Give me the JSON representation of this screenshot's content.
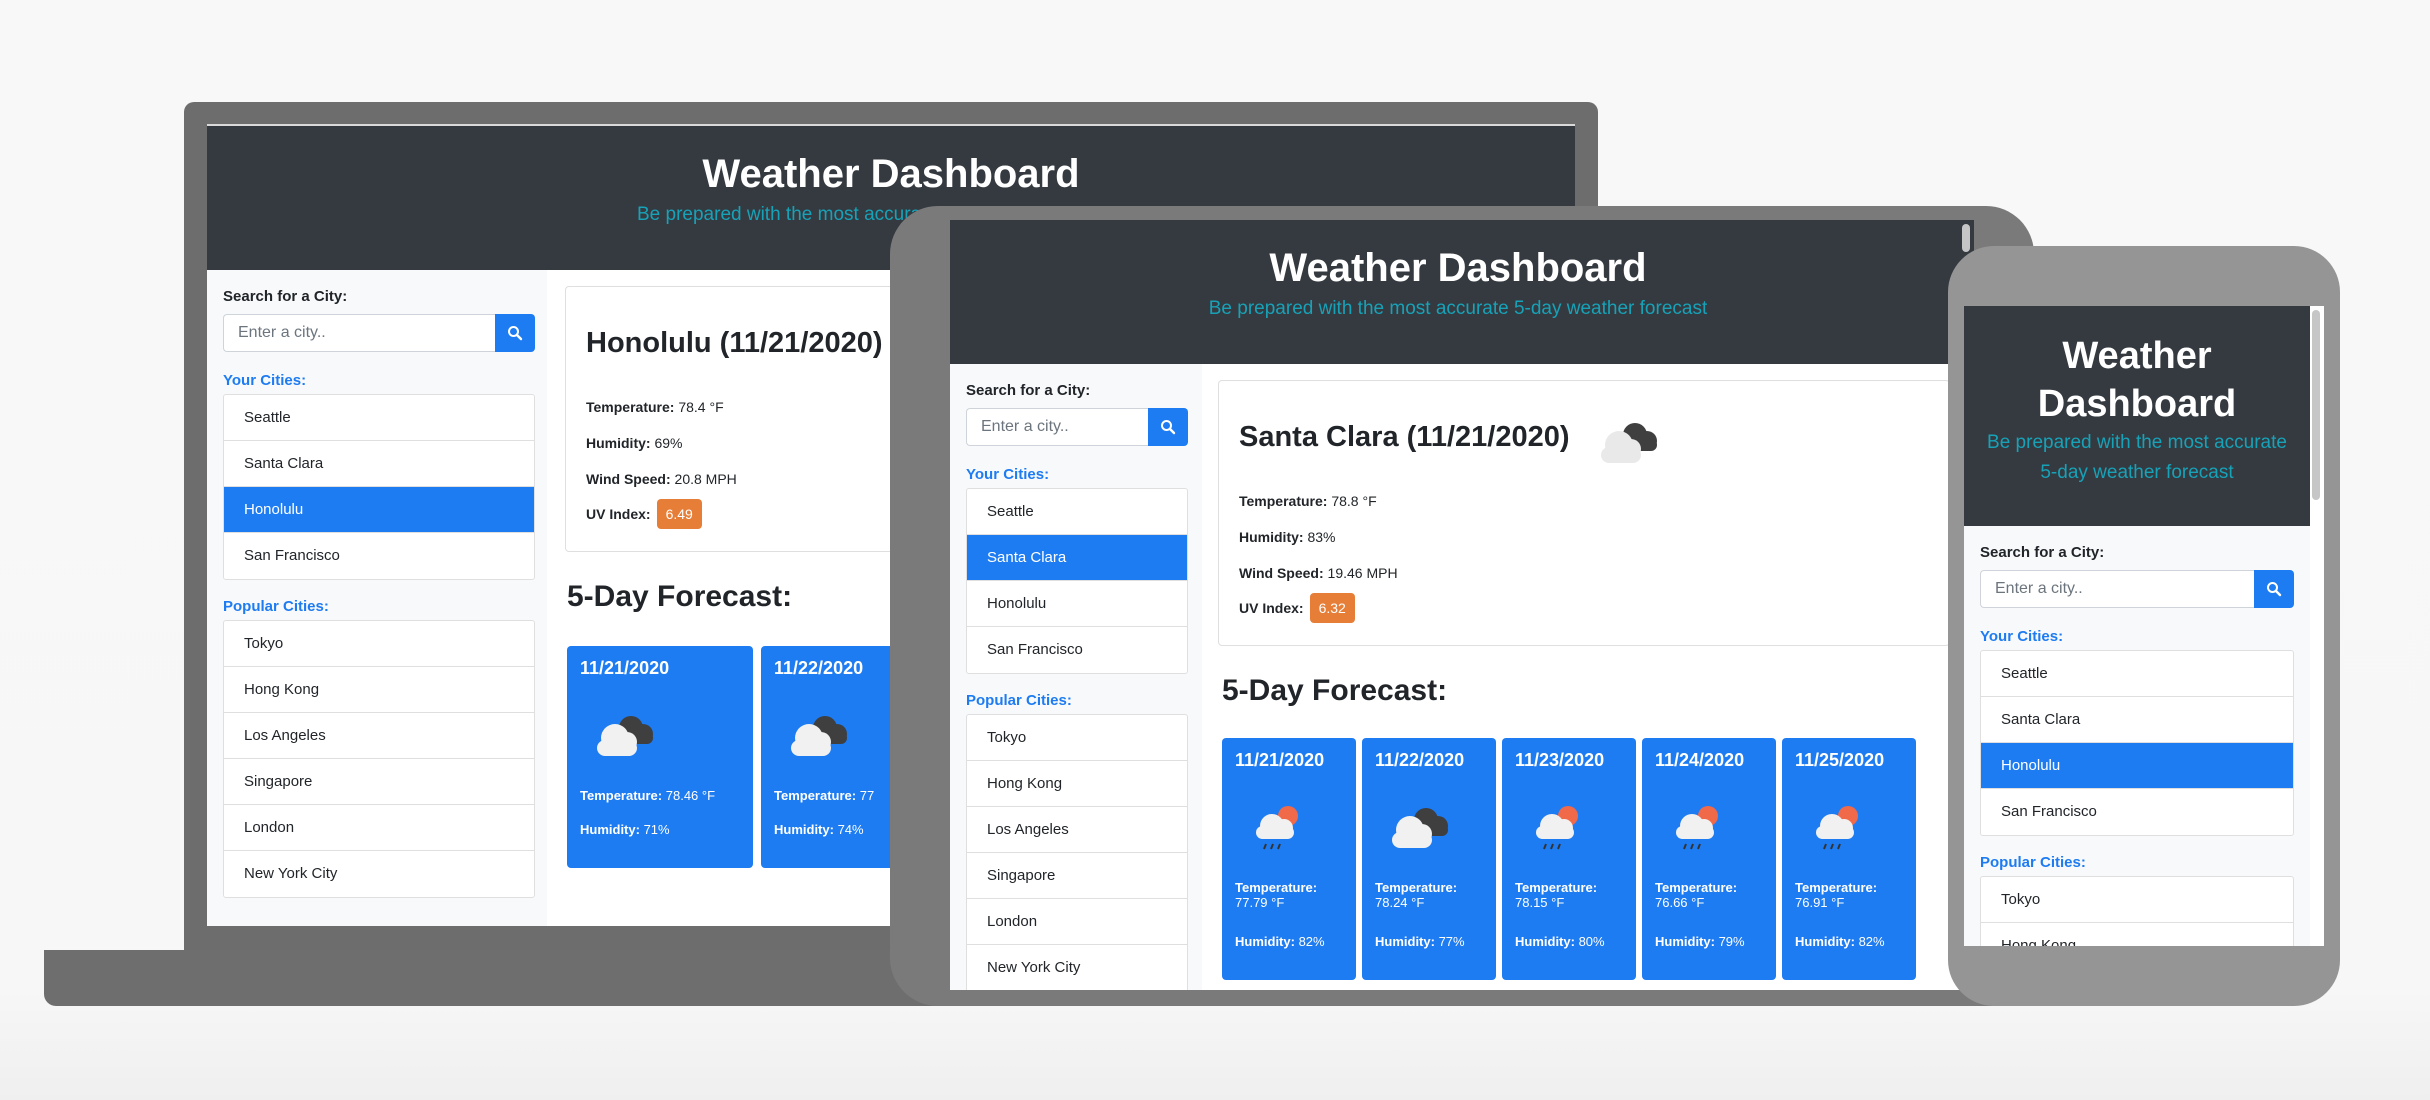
{
  "app": {
    "title": "Weather Dashboard",
    "subtitle": "Be prepared with the most accurate 5-day weather forecast",
    "subtitle_cropped": "Be prepared with the most accura"
  },
  "sidebar": {
    "search_label": "Search for a City:",
    "search_placeholder": "Enter a city..",
    "your_cities_label": "Your Cities:",
    "popular_cities_label": "Popular Cities:",
    "your_cities": [
      "Seattle",
      "Santa Clara",
      "Honolulu",
      "San Francisco"
    ],
    "popular_cities": [
      "Tokyo",
      "Hong Kong",
      "Los Angeles",
      "Singapore",
      "London",
      "New York City"
    ]
  },
  "laptop": {
    "selected_city": "Honolulu",
    "current": {
      "title": "Honolulu (11/21/2020)",
      "temperature_label": "Temperature:",
      "temperature": "78.4 °F",
      "humidity_label": "Humidity:",
      "humidity": "69%",
      "wind_label": "Wind Speed:",
      "wind": "20.8 MPH",
      "uv_label": "UV Index:",
      "uv": "6.49"
    },
    "forecast_title": "5-Day Forecast:",
    "forecast": [
      {
        "date": "11/21/2020",
        "icon": "cloudy-icon",
        "temp": "78.46 °F",
        "humidity": "71%"
      },
      {
        "date": "11/22/2020",
        "icon": "cloudy-icon",
        "temp": "77",
        "humidity": "74%"
      }
    ]
  },
  "tablet": {
    "selected_city": "Santa Clara",
    "current": {
      "title": "Santa Clara (11/21/2020)",
      "temperature_label": "Temperature:",
      "temperature": "78.8 °F",
      "humidity_label": "Humidity:",
      "humidity": "83%",
      "wind_label": "Wind Speed:",
      "wind": "19.46 MPH",
      "uv_label": "UV Index:",
      "uv": "6.32",
      "icon": "cloudy-icon"
    },
    "forecast_title": "5-Day Forecast:",
    "forecast": [
      {
        "date": "11/21/2020",
        "icon": "rain-sun-icon",
        "temp_label": "Temperature:",
        "temp": "77.79 °F",
        "humidity_label": "Humidity:",
        "humidity": "82%"
      },
      {
        "date": "11/22/2020",
        "icon": "cloudy-icon",
        "temp_label": "Temperature:",
        "temp": "78.24 °F",
        "humidity_label": "Humidity:",
        "humidity": "77%"
      },
      {
        "date": "11/23/2020",
        "icon": "rain-sun-icon",
        "temp_label": "Temperature:",
        "temp": "78.15 °F",
        "humidity_label": "Humidity:",
        "humidity": "80%"
      },
      {
        "date": "11/24/2020",
        "icon": "rain-sun-icon",
        "temp_label": "Temperature:",
        "temp": "76.66 °F",
        "humidity_label": "Humidity:",
        "humidity": "79%"
      },
      {
        "date": "11/25/2020",
        "icon": "rain-sun-icon",
        "temp_label": "Temperature:",
        "temp": "76.91 °F",
        "humidity_label": "Humidity:",
        "humidity": "82%"
      }
    ]
  },
  "phone": {
    "title_line1": "Weather",
    "title_line2": "Dashboard",
    "subtitle_line1": "Be prepared with the most accurate",
    "subtitle_line2": "5-day weather forecast",
    "selected_city": "Honolulu",
    "popular_visible": [
      "Tokyo",
      "Hong Kong"
    ]
  },
  "colors": {
    "header_bg": "#343a40",
    "subtitle": "#17a2b8",
    "accent": "#1e7cf2",
    "uv_badge": "#e67e38"
  }
}
